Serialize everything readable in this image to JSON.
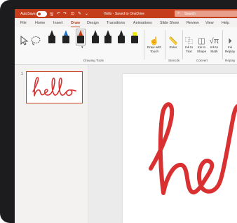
{
  "titlebar": {
    "autosave_label": "AutoSave",
    "toggle_state": "On",
    "doc_title": "Hello - Saved to OneDrive",
    "search_placeholder": "Search",
    "accent": "#c43e1c"
  },
  "tabs": [
    "File",
    "Home",
    "Insert",
    "Draw",
    "Design",
    "Transitions",
    "Animations",
    "Slide Show",
    "Review",
    "View",
    "Help"
  ],
  "active_tab": "Draw",
  "ribbon": {
    "drawing_tools_label": "Drawing Tools",
    "stencils_label": "Stencils",
    "convert_label": "Convert",
    "replay_label": "Replay",
    "draw_with_touch": "Draw with Touch",
    "ruler": "Ruler",
    "ink_to_text": "Ink to Text",
    "ink_to_shape": "Ink to Shape",
    "ink_to_math": "Ink to Math",
    "ink_replay": "Ink Replay",
    "pens": [
      {
        "color": "#222222"
      },
      {
        "color": "#1e73c8"
      },
      {
        "color": "#c43e1c"
      },
      {
        "color": "#222222"
      },
      {
        "color": "#222222"
      },
      {
        "color": "#222222"
      },
      {
        "color": "#f2e70f"
      }
    ]
  },
  "slides": {
    "number": "1",
    "ink_text": "hello",
    "ink_color": "#d93131"
  }
}
